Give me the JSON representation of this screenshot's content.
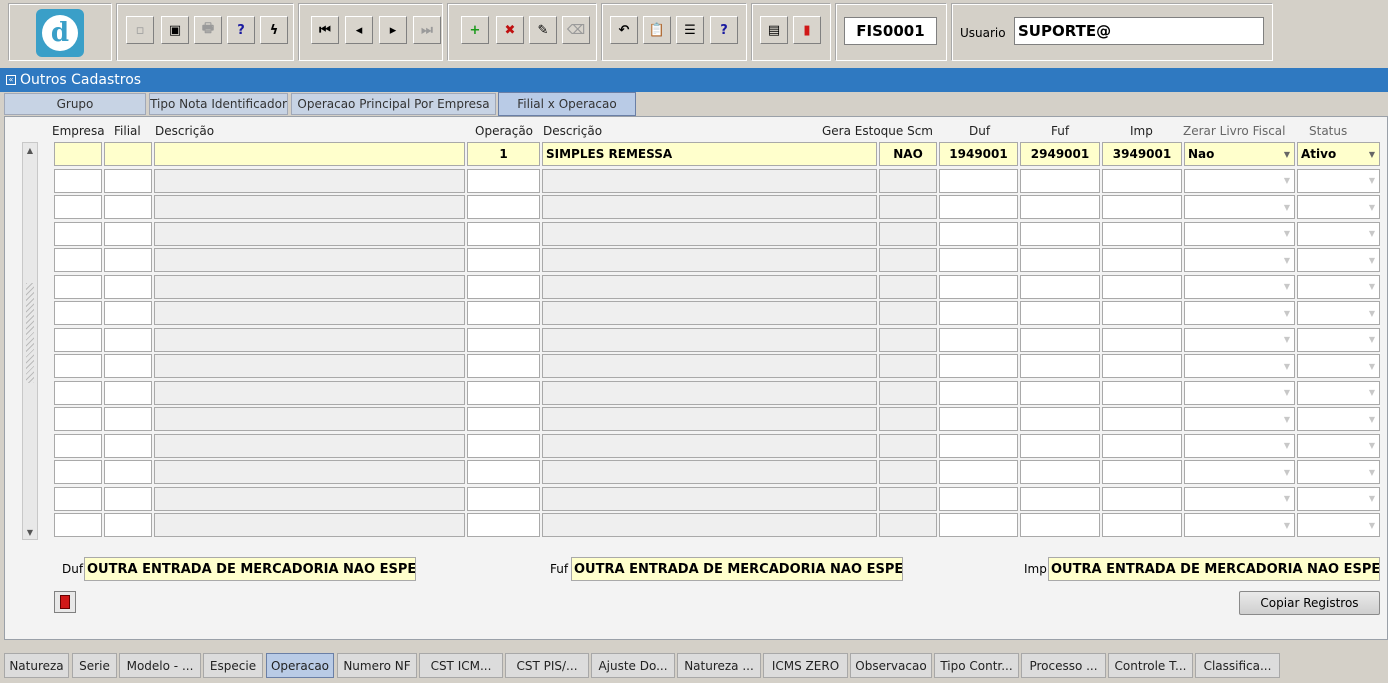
{
  "toolbar": {
    "logo_letter": "d",
    "buttons": [
      {
        "icon": "save-icon",
        "glyph": "▫"
      },
      {
        "icon": "window-icon",
        "glyph": "▣"
      },
      {
        "icon": "print-icon",
        "glyph": "🖶"
      },
      {
        "icon": "query-help-icon",
        "glyph": "?"
      },
      {
        "icon": "execute-query-icon",
        "glyph": "ϟ"
      },
      {
        "icon": "first-record-icon",
        "glyph": "⏮"
      },
      {
        "icon": "previous-record-icon",
        "glyph": "◂"
      },
      {
        "icon": "next-record-icon",
        "glyph": "▸"
      },
      {
        "icon": "last-record-icon",
        "glyph": "⏭"
      },
      {
        "icon": "insert-record-icon",
        "glyph": "+"
      },
      {
        "icon": "delete-record-icon",
        "glyph": "✖"
      },
      {
        "icon": "edit-record-icon",
        "glyph": "✎"
      },
      {
        "icon": "clear-record-icon",
        "glyph": "⌫"
      },
      {
        "icon": "undo-icon",
        "glyph": "↶"
      },
      {
        "icon": "clipboard-icon",
        "glyph": "📋"
      },
      {
        "icon": "list-values-icon",
        "glyph": "☰"
      },
      {
        "icon": "help-icon",
        "glyph": "?"
      },
      {
        "icon": "menu-icon",
        "glyph": "▤"
      },
      {
        "icon": "exit-icon",
        "glyph": "▮"
      }
    ],
    "form_code": "FIS0001",
    "user_label": "Usuario",
    "user_value": "SUPORTE@"
  },
  "window": {
    "title": "Outros Cadastros"
  },
  "tabs": [
    "Grupo",
    "Tipo Nota Identificador",
    "Operacao Principal Por Empresa",
    "Filial x Operacao"
  ],
  "columns": {
    "empresa": "Empresa",
    "filial": "Filial",
    "descricao1": "Descrição",
    "operacao": "Operação",
    "descricao2": "Descrição",
    "gera_estoque": "Gera Estoque Scm",
    "duf": "Duf",
    "fuf": "Fuf",
    "imp": "Imp",
    "zerar_livro": "Zerar Livro Fiscal",
    "status": "Status"
  },
  "rows": [
    {
      "empresa": "",
      "filial": "",
      "descricao1": "",
      "operacao": "1",
      "descricao2": "SIMPLES REMESSA",
      "gera_estoque": "NAO",
      "duf": "1949001",
      "fuf": "2949001",
      "imp": "3949001",
      "zerar_livro": "Nao",
      "status": "Ativo"
    }
  ],
  "empty_rows": 14,
  "footer": {
    "duf_label": "Duf",
    "duf_value": "OUTRA ENTRADA DE MERCADORIA NAO ESPECIFICADA",
    "fuf_label": "Fuf",
    "fuf_value": "OUTRA ENTRADA DE MERCADORIA NAO ESPECIFICADA",
    "imp_label": "Imp",
    "imp_value": "OUTRA ENTRADA DE MERCADORIA NAO ESPECIFICADA",
    "copy_button": "Copiar Registros"
  },
  "bottom_tabs": [
    "Natureza",
    "Serie",
    "Modelo - ...",
    "Especie",
    "Operacao",
    "Numero NF",
    "CST ICM...",
    "CST PIS/...",
    "Ajuste Do...",
    "Natureza ...",
    "ICMS ZERO",
    "Observacao",
    "Tipo Contr...",
    "Processo ...",
    "Controle T...",
    "Classifica..."
  ],
  "active_tab": "Filial x Operacao",
  "active_bottom_tab": "Operacao"
}
